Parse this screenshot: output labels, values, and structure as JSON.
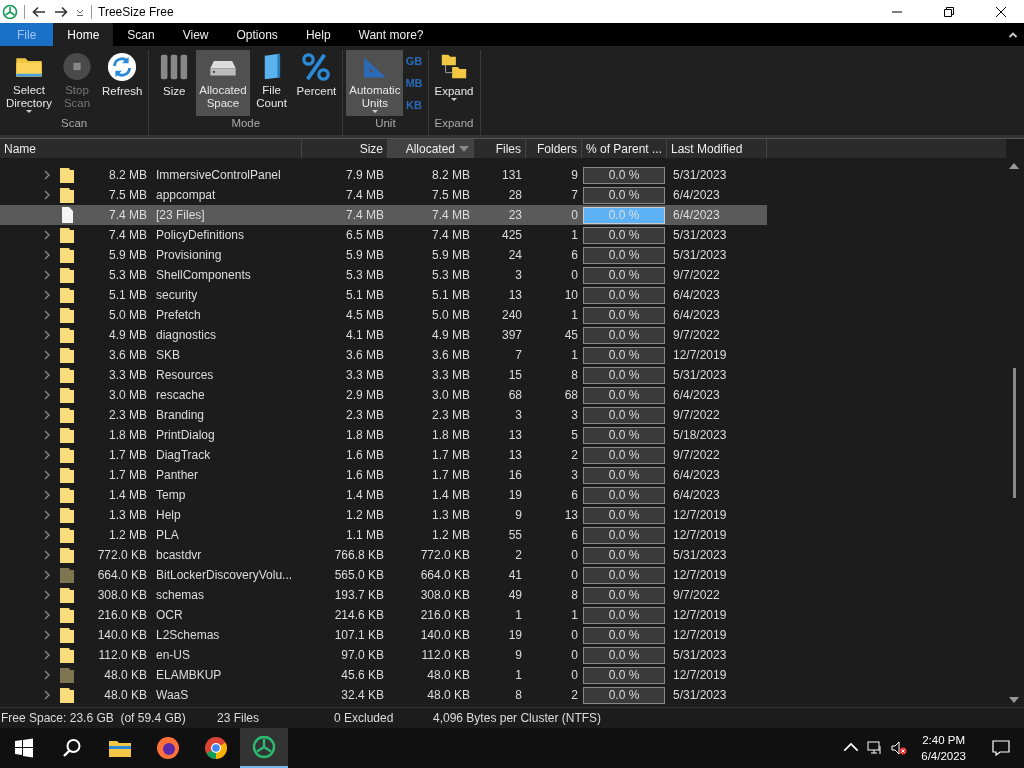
{
  "window": {
    "title": "TreeSize Free"
  },
  "menu_tabs": [
    {
      "label": "File",
      "kind": "file",
      "selected": false
    },
    {
      "label": "Home",
      "kind": "tab",
      "selected": true
    },
    {
      "label": "Scan",
      "kind": "tab",
      "selected": false
    },
    {
      "label": "View",
      "kind": "tab",
      "selected": false
    },
    {
      "label": "Options",
      "kind": "tab",
      "selected": false
    },
    {
      "label": "Help",
      "kind": "tab",
      "selected": false
    },
    {
      "label": "Want more?",
      "kind": "tab",
      "selected": false
    }
  ],
  "ribbon_groups": [
    {
      "label": "Scan",
      "buttons": [
        {
          "lines": [
            "Select",
            "Directory"
          ],
          "kind": "folder",
          "dropdown": true,
          "selected": false,
          "disabled": false
        },
        {
          "lines": [
            "Stop",
            "Scan"
          ],
          "kind": "stop",
          "dropdown": false,
          "selected": false,
          "disabled": true
        },
        {
          "lines": [
            "Refresh"
          ],
          "kind": "refresh",
          "dropdown": false,
          "selected": false,
          "disabled": false
        }
      ]
    },
    {
      "label": "Mode",
      "buttons": [
        {
          "lines": [
            "Size"
          ],
          "kind": "bars",
          "dropdown": false,
          "selected": false,
          "disabled": false
        },
        {
          "lines": [
            "Allocated",
            "Space"
          ],
          "kind": "drive",
          "dropdown": false,
          "selected": true,
          "disabled": false
        },
        {
          "lines": [
            "File",
            "Count"
          ],
          "kind": "files",
          "dropdown": false,
          "selected": false,
          "disabled": false
        },
        {
          "lines": [
            "Percent"
          ],
          "kind": "percent",
          "dropdown": false,
          "selected": false,
          "disabled": false
        }
      ]
    },
    {
      "label": "Unit",
      "buttons": [
        {
          "lines": [
            "Automatic",
            "Units"
          ],
          "kind": "ruler",
          "dropdown": true,
          "selected": true,
          "disabled": false
        }
      ],
      "small": [
        "GB",
        "MB",
        "KB"
      ]
    },
    {
      "label": "Expand",
      "buttons": [
        {
          "lines": [
            "Expand"
          ],
          "kind": "tree",
          "dropdown": true,
          "selected": false,
          "disabled": false
        }
      ]
    }
  ],
  "table": {
    "columns": [
      {
        "label": "Name",
        "sorted": false
      },
      {
        "label": "Size",
        "sorted": false
      },
      {
        "label": "Allocated",
        "sorted": true
      },
      {
        "label": "Files",
        "sorted": false
      },
      {
        "label": "Folders",
        "sorted": false
      },
      {
        "label": "% of Parent ...",
        "sorted": false
      },
      {
        "label": "Last Modified",
        "sorted": false
      }
    ],
    "rows": [
      {
        "kind": "folder",
        "expandable": true,
        "total": "8.2 MB",
        "name": "ImmersiveControlPanel",
        "size": "7.9 MB",
        "allocated": "8.2 MB",
        "files": "131",
        "folders": "9",
        "percent": "0.0 %",
        "level": 0,
        "modified": "5/31/2023",
        "selected": false
      },
      {
        "kind": "folder",
        "expandable": true,
        "total": "7.5 MB",
        "name": "appcompat",
        "size": "7.4 MB",
        "allocated": "7.5 MB",
        "files": "28",
        "folders": "7",
        "percent": "0.0 %",
        "level": 0,
        "modified": "6/4/2023",
        "selected": false
      },
      {
        "kind": "file",
        "expandable": false,
        "total": "7.4 MB",
        "name": "[23 Files]",
        "size": "7.4 MB",
        "allocated": "7.4 MB",
        "files": "23",
        "folders": "0",
        "percent": "0.0 %",
        "level": 0,
        "modified": "6/4/2023",
        "selected": true
      },
      {
        "kind": "folder",
        "expandable": true,
        "total": "7.4 MB",
        "name": "PolicyDefinitions",
        "size": "6.5 MB",
        "allocated": "7.4 MB",
        "files": "425",
        "folders": "1",
        "percent": "0.0 %",
        "level": 0,
        "modified": "5/31/2023",
        "selected": false
      },
      {
        "kind": "folder",
        "expandable": true,
        "total": "5.9 MB",
        "name": "Provisioning",
        "size": "5.9 MB",
        "allocated": "5.9 MB",
        "files": "24",
        "folders": "6",
        "percent": "0.0 %",
        "level": 0,
        "modified": "5/31/2023",
        "selected": false
      },
      {
        "kind": "folder",
        "expandable": true,
        "total": "5.3 MB",
        "name": "ShellComponents",
        "size": "5.3 MB",
        "allocated": "5.3 MB",
        "files": "3",
        "folders": "0",
        "percent": "0.0 %",
        "level": 0,
        "modified": "9/7/2022",
        "selected": false
      },
      {
        "kind": "folder",
        "expandable": true,
        "total": "5.1 MB",
        "name": "security",
        "size": "5.1 MB",
        "allocated": "5.1 MB",
        "files": "13",
        "folders": "10",
        "percent": "0.0 %",
        "level": 0,
        "modified": "6/4/2023",
        "selected": false
      },
      {
        "kind": "folder",
        "expandable": true,
        "total": "5.0 MB",
        "name": "Prefetch",
        "size": "4.5 MB",
        "allocated": "5.0 MB",
        "files": "240",
        "folders": "1",
        "percent": "0.0 %",
        "level": 0,
        "modified": "6/4/2023",
        "selected": false
      },
      {
        "kind": "folder",
        "expandable": true,
        "total": "4.9 MB",
        "name": "diagnostics",
        "size": "4.1 MB",
        "allocated": "4.9 MB",
        "files": "397",
        "folders": "45",
        "percent": "0.0 %",
        "level": 0,
        "modified": "9/7/2022",
        "selected": false
      },
      {
        "kind": "folder",
        "expandable": true,
        "total": "3.6 MB",
        "name": "SKB",
        "size": "3.6 MB",
        "allocated": "3.6 MB",
        "files": "7",
        "folders": "1",
        "percent": "0.0 %",
        "level": 0,
        "modified": "12/7/2019",
        "selected": false
      },
      {
        "kind": "folder",
        "expandable": true,
        "total": "3.3 MB",
        "name": "Resources",
        "size": "3.3 MB",
        "allocated": "3.3 MB",
        "files": "15",
        "folders": "8",
        "percent": "0.0 %",
        "level": 0,
        "modified": "5/31/2023",
        "selected": false
      },
      {
        "kind": "folder",
        "expandable": true,
        "total": "3.0 MB",
        "name": "rescache",
        "size": "2.9 MB",
        "allocated": "3.0 MB",
        "files": "68",
        "folders": "68",
        "percent": "0.0 %",
        "level": 0,
        "modified": "6/4/2023",
        "selected": false
      },
      {
        "kind": "folder",
        "expandable": true,
        "total": "2.3 MB",
        "name": "Branding",
        "size": "2.3 MB",
        "allocated": "2.3 MB",
        "files": "3",
        "folders": "3",
        "percent": "0.0 %",
        "level": 0,
        "modified": "9/7/2022",
        "selected": false
      },
      {
        "kind": "folder",
        "expandable": true,
        "total": "1.8 MB",
        "name": "PrintDialog",
        "size": "1.8 MB",
        "allocated": "1.8 MB",
        "files": "13",
        "folders": "5",
        "percent": "0.0 %",
        "level": 0,
        "modified": "5/18/2023",
        "selected": false
      },
      {
        "kind": "folder",
        "expandable": true,
        "total": "1.7 MB",
        "name": "DiagTrack",
        "size": "1.6 MB",
        "allocated": "1.7 MB",
        "files": "13",
        "folders": "2",
        "percent": "0.0 %",
        "level": 0,
        "modified": "9/7/2022",
        "selected": false
      },
      {
        "kind": "folder",
        "expandable": true,
        "total": "1.7 MB",
        "name": "Panther",
        "size": "1.6 MB",
        "allocated": "1.7 MB",
        "files": "16",
        "folders": "3",
        "percent": "0.0 %",
        "level": 0,
        "modified": "6/4/2023",
        "selected": false
      },
      {
        "kind": "folder",
        "expandable": true,
        "total": "1.4 MB",
        "name": "Temp",
        "size": "1.4 MB",
        "allocated": "1.4 MB",
        "files": "19",
        "folders": "6",
        "percent": "0.0 %",
        "level": 0,
        "modified": "6/4/2023",
        "selected": false
      },
      {
        "kind": "folder",
        "expandable": true,
        "total": "1.3 MB",
        "name": "Help",
        "size": "1.2 MB",
        "allocated": "1.3 MB",
        "files": "9",
        "folders": "13",
        "percent": "0.0 %",
        "level": 0,
        "modified": "12/7/2019",
        "selected": false
      },
      {
        "kind": "folder",
        "expandable": true,
        "total": "1.2 MB",
        "name": "PLA",
        "size": "1.1 MB",
        "allocated": "1.2 MB",
        "files": "55",
        "folders": "6",
        "percent": "0.0 %",
        "level": 0,
        "modified": "12/7/2019",
        "selected": false
      },
      {
        "kind": "folder",
        "expandable": true,
        "total": "772.0 KB",
        "name": "bcastdvr",
        "size": "766.8 KB",
        "allocated": "772.0 KB",
        "files": "2",
        "folders": "0",
        "percent": "0.0 %",
        "level": 0,
        "modified": "5/31/2023",
        "selected": false
      },
      {
        "kind": "restricted",
        "expandable": true,
        "total": "664.0 KB",
        "name": "BitLockerDiscoveryVolu...",
        "size": "565.0 KB",
        "allocated": "664.0 KB",
        "files": "41",
        "folders": "0",
        "percent": "0.0 %",
        "level": 0,
        "modified": "12/7/2019",
        "selected": false
      },
      {
        "kind": "folder",
        "expandable": true,
        "total": "308.0 KB",
        "name": "schemas",
        "size": "193.7 KB",
        "allocated": "308.0 KB",
        "files": "49",
        "folders": "8",
        "percent": "0.0 %",
        "level": 0,
        "modified": "9/7/2022",
        "selected": false
      },
      {
        "kind": "folder",
        "expandable": true,
        "total": "216.0 KB",
        "name": "OCR",
        "size": "214.6 KB",
        "allocated": "216.0 KB",
        "files": "1",
        "folders": "1",
        "percent": "0.0 %",
        "level": 0,
        "modified": "12/7/2019",
        "selected": false
      },
      {
        "kind": "folder",
        "expandable": true,
        "total": "140.0 KB",
        "name": "L2Schemas",
        "size": "107.1 KB",
        "allocated": "140.0 KB",
        "files": "19",
        "folders": "0",
        "percent": "0.0 %",
        "level": 0,
        "modified": "12/7/2019",
        "selected": false
      },
      {
        "kind": "folder",
        "expandable": true,
        "total": "112.0 KB",
        "name": "en-US",
        "size": "97.0 KB",
        "allocated": "112.0 KB",
        "files": "9",
        "folders": "0",
        "percent": "0.0 %",
        "level": 0,
        "modified": "5/31/2023",
        "selected": false
      },
      {
        "kind": "restricted",
        "expandable": true,
        "total": "48.0 KB",
        "name": "ELAMBKUP",
        "size": "45.6 KB",
        "allocated": "48.0 KB",
        "files": "1",
        "folders": "0",
        "percent": "0.0 %",
        "level": 0,
        "modified": "12/7/2019",
        "selected": false
      },
      {
        "kind": "folder",
        "expandable": true,
        "total": "48.0 KB",
        "name": "WaaS",
        "size": "32.4 KB",
        "allocated": "48.0 KB",
        "files": "8",
        "folders": "2",
        "percent": "0.0 %",
        "level": 0,
        "modified": "5/31/2023",
        "selected": false
      }
    ]
  },
  "status_bar": [
    "Free Space: 23.6 GB  (of 59.4 GB)",
    "23 Files",
    "0 Excluded",
    "4,096 Bytes per Cluster (NTFS)"
  ],
  "taskbar": {
    "apps": [
      {
        "kind": "explorer",
        "selected": false
      },
      {
        "kind": "firefox",
        "selected": false
      },
      {
        "kind": "chrome",
        "selected": false
      },
      {
        "kind": "treesize",
        "selected": true
      }
    ],
    "time": "2:40 PM",
    "date": "6/4/2023"
  }
}
